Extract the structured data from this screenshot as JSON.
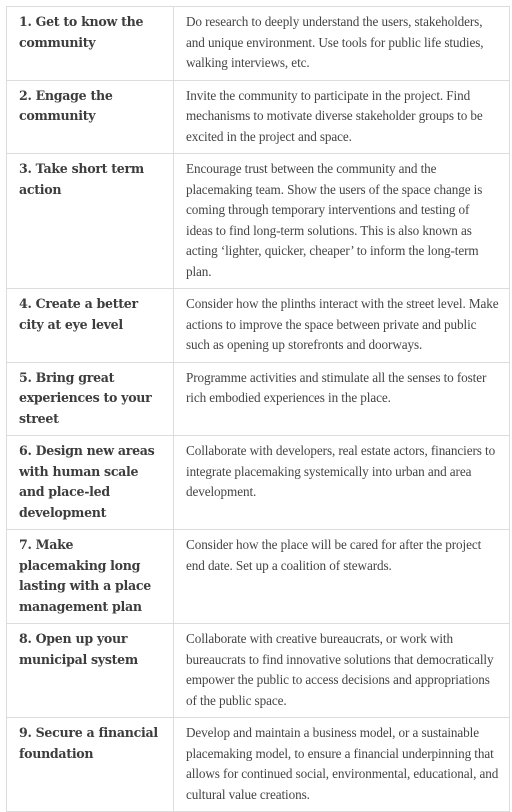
{
  "table": {
    "rows": [
      {
        "step": "1. Get to know the community",
        "description": "Do research to deeply understand the users, stakeholders, and unique environment. Use tools for public life studies, walking interviews, etc."
      },
      {
        "step": "2. Engage the community",
        "description": "Invite the community to participate in the project. Find mechanisms to motivate diverse stakeholder groups to be excited in the project and space."
      },
      {
        "step": "3. Take short term action",
        "description": "Encourage trust between the community and the placemaking team. Show the users of the space change is coming through temporary interventions and testing of ideas to find long-term solutions. This is also known as acting ‘lighter, quicker, cheaper’ to inform the long-term plan."
      },
      {
        "step": "4. Create a better city at eye level",
        "description": "Consider how the plinths interact with the street level. Make actions to improve the space between private and public such as opening up storefronts and doorways."
      },
      {
        "step": "5. Bring great experiences to your street",
        "description": "Programme activities and stimulate all the senses to foster rich embodied experiences in the place."
      },
      {
        "step": "6. Design new areas with human scale and place-led development",
        "description": "Collaborate with developers, real estate actors, financiers to integrate placemaking systemically into urban and area development."
      },
      {
        "step": "7. Make placemaking long lasting with a place management plan",
        "description": "Consider how the place will be cared for after the project end date. Set up a coalition of stewards."
      },
      {
        "step": "8. Open up your municipal system",
        "description": "Collaborate with creative bureaucrats, or work with bureaucrats to find innovative solutions that democratically empower the public to access decisions and appropriations of the public space."
      },
      {
        "step": "9. Secure a financial foundation",
        "description": "Develop and maintain a business model, or a sustainable placemaking model, to ensure a financial underpinning that allows for continued social, environmental, educational, and cultural value creations."
      }
    ]
  }
}
